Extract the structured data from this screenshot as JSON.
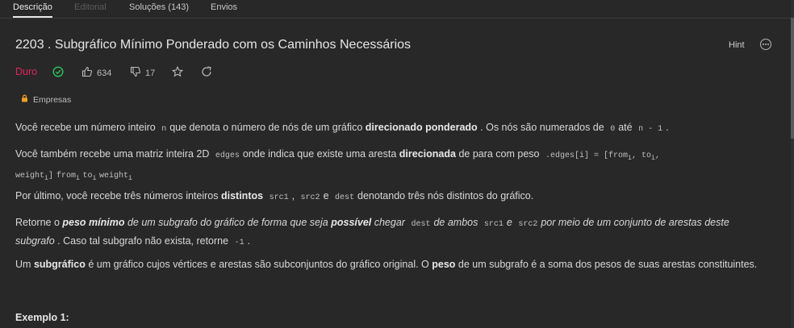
{
  "tabs": [
    "Descrição",
    "Editorial",
    "Soluções (143)",
    "Envios"
  ],
  "problem": {
    "title": "2203 . Subgráfico Mínimo Ponderado com os Caminhos Necessários",
    "hint_label": "Hint",
    "difficulty": "Duro",
    "likes": "634",
    "dislikes": "17",
    "company_label": "Empresas"
  },
  "para1": {
    "t1": "Você recebe um número inteiro",
    "c1": "n",
    "t2": "que denota o número de nós de um gráfico",
    "b1": "direcionado ponderado",
    "t3": ". Os nós são numerados de",
    "c2": "0",
    "t4": "até",
    "c3": "n - 1",
    "t5": "."
  },
  "para2": {
    "t1": "Você também recebe uma matriz inteira 2D",
    "c1": "edges",
    "t2": "onde indica que existe uma aresta",
    "b1": "direcionada",
    "t3": "de para com peso",
    "c2": ".edges[i] = [from",
    "c2s": "i",
    "c3": ", to",
    "c3s": "i",
    "c4": ",",
    "c5": "weight",
    "c5s": "i",
    "c6": "]",
    "c7": "from",
    "c7s": "i",
    "c8": "to",
    "c8s": "i",
    "c9": "weight",
    "c9s": "i"
  },
  "para3": {
    "t1": "Por último, você recebe três números inteiros",
    "b1": "distintos",
    "c1": "src1",
    "t2": ",",
    "c2": "src2",
    "t3": "e",
    "c3": "dest",
    "t4": "denotando três nós distintos do gráfico."
  },
  "para4": {
    "t1": "Retorne o",
    "b1": "peso mínimo",
    "t2": "de um subgrafo do gráfico de forma que seja",
    "b2": "possível",
    "t3": "chegar",
    "c1": "dest",
    "t4": "de ambos",
    "c2": "src1",
    "t5": "e",
    "c3": "src2",
    "t6": "por meio de um conjunto de arestas deste",
    "t7": "subgrafo",
    "t8": ". Caso tal subgrafo não exista, retorne",
    "c4": "-1",
    "t9": "."
  },
  "para5": {
    "t1": "Um",
    "b1": "subgráfico",
    "t2": "é um gráfico cujos vértices e arestas são subconjuntos do gráfico original. O",
    "b2": "peso",
    "t3": "de um subgrafo é a soma dos pesos de suas arestas constituintes."
  },
  "example_heading": "Exemplo 1:"
}
